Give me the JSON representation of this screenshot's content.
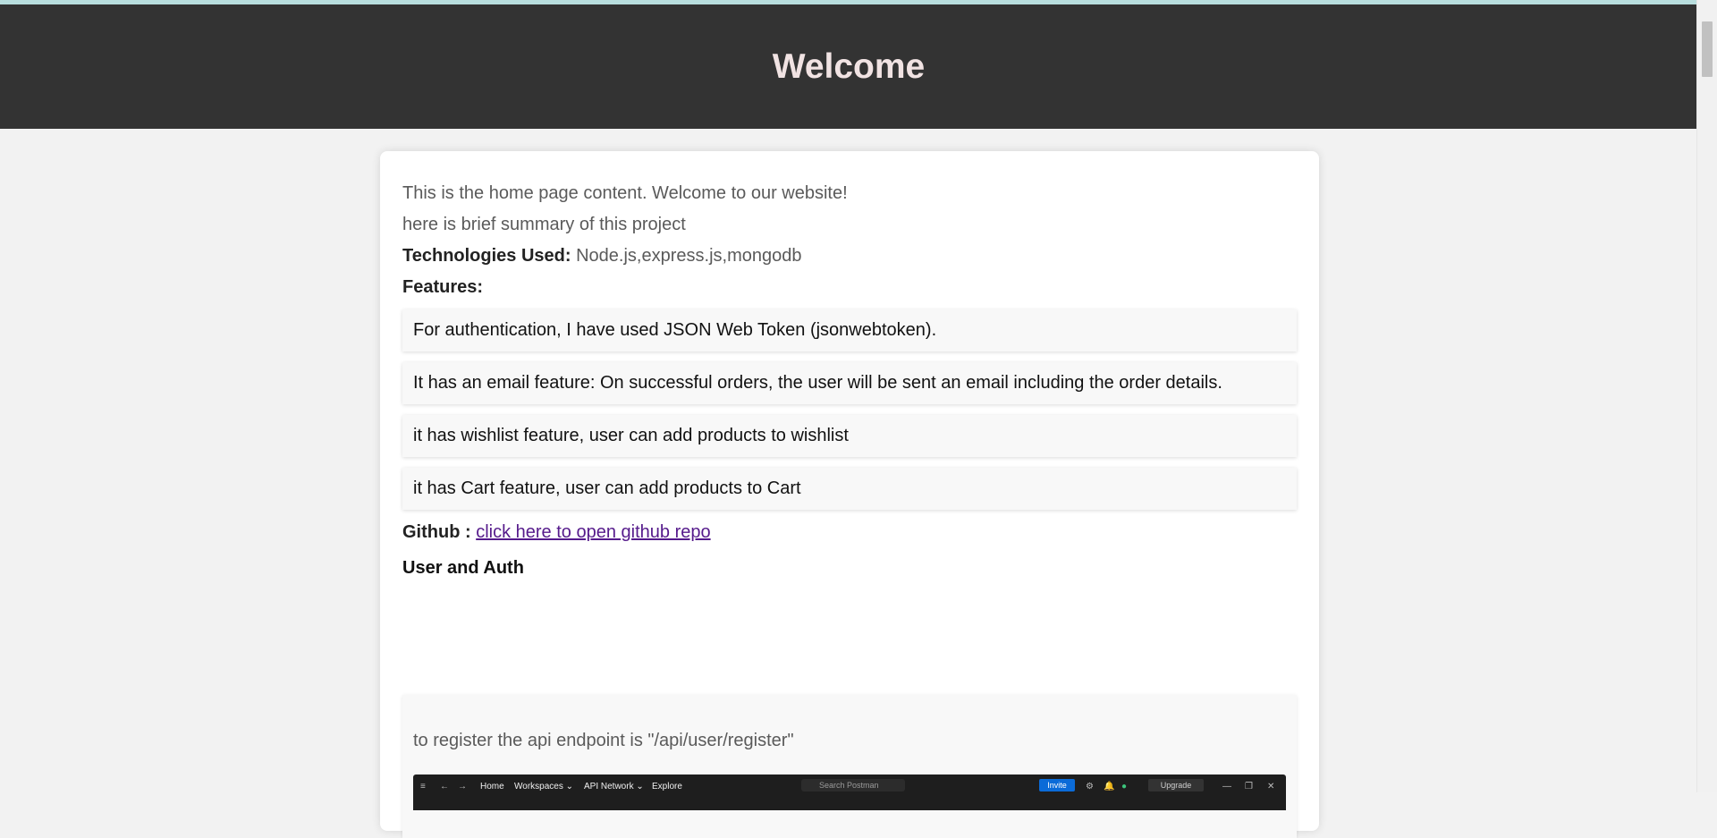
{
  "header": {
    "title": "Welcome"
  },
  "intro": {
    "line1": "This is the home page content. Welcome to our website!",
    "line2": "here is brief summary of this project",
    "tech_label": "Technologies Used:",
    "tech_value": "Node.js,express.js,mongodb",
    "features_label": "Features:"
  },
  "features": [
    "For authentication, I have used JSON Web Token (jsonwebtoken).",
    "It has an email feature: On successful orders, the user will be sent an email including the order details.",
    "it has wishlist feature, user can add products to wishlist",
    "it has Cart feature, user can add products to Cart"
  ],
  "github": {
    "label": "Github :",
    "link_text": "click here to open github repo"
  },
  "section_user_auth": {
    "title": "User and Auth"
  },
  "endpoint": {
    "register_text": "to register the api endpoint is \"/api/user/register\""
  },
  "embedded_screenshot": {
    "menu_icon": "≡",
    "back_icon": "←",
    "forward_icon": "→",
    "nav": [
      "Home",
      "Workspaces",
      "API Network",
      "Explore"
    ],
    "search_placeholder": "Search Postman",
    "invite_label": "Invite",
    "upgrade_label": "Upgrade",
    "settings_icon": "⚙",
    "bell_icon": "🔔",
    "minimize_icon": "—",
    "maximize_icon": "❐",
    "close_icon": "✕"
  },
  "colors": {
    "header_bg": "#333333",
    "header_text": "#f1e3e3",
    "page_bg": "#f2f2f2",
    "link": "#551a8b"
  }
}
